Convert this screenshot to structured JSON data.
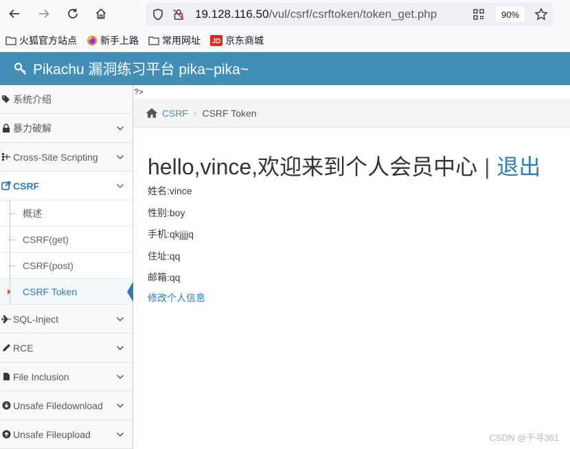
{
  "browser": {
    "url_host": "19.128.116.50",
    "url_path": "/vul/csrf/csrftoken/token_get.php",
    "zoom": "90%",
    "bookmarks": [
      {
        "label": "火狐官方站点",
        "icon": "folder-icon"
      },
      {
        "label": "新手上路",
        "icon": "firefox-icon"
      },
      {
        "label": "常用网址",
        "icon": "folder-icon"
      },
      {
        "label": "京东商城",
        "icon": "jd-icon"
      }
    ]
  },
  "app": {
    "title": "Pikachu 漏洞练习平台 pika~pika~",
    "brand_color": "#438eb9"
  },
  "sidebar": {
    "items": [
      {
        "label": "系统介绍",
        "icon": "tags-icon"
      },
      {
        "label": "暴力破解",
        "icon": "lock-icon"
      },
      {
        "label": "Cross-Site Scripting",
        "icon": "sitemap-icon"
      },
      {
        "label": "CSRF",
        "icon": "share-icon"
      },
      {
        "label": "SQL-Inject",
        "icon": "plane-icon"
      },
      {
        "label": "RCE",
        "icon": "pencil-icon"
      },
      {
        "label": "File Inclusion",
        "icon": "file-icon"
      },
      {
        "label": "Unsafe Filedownload",
        "icon": "download-icon"
      },
      {
        "label": "Unsafe Fileupload",
        "icon": "upload-icon"
      }
    ],
    "csrf_sub": [
      "概述",
      "CSRF(get)",
      "CSRF(post)",
      "CSRF Token"
    ]
  },
  "main": {
    "stray_text": "?>",
    "breadcrumb": {
      "parent": "CSRF",
      "current": "CSRF Token"
    },
    "welcome": "hello,vince,欢迎来到个人会员中心",
    "separator": "|",
    "logout": "退出",
    "info": [
      "姓名:vince",
      "性别:boy",
      "手机:qkjjjjq",
      "住址:qq",
      "邮箱:qq"
    ],
    "edit_link": "修改个人信息"
  },
  "watermark": "CSDN @千寻361"
}
